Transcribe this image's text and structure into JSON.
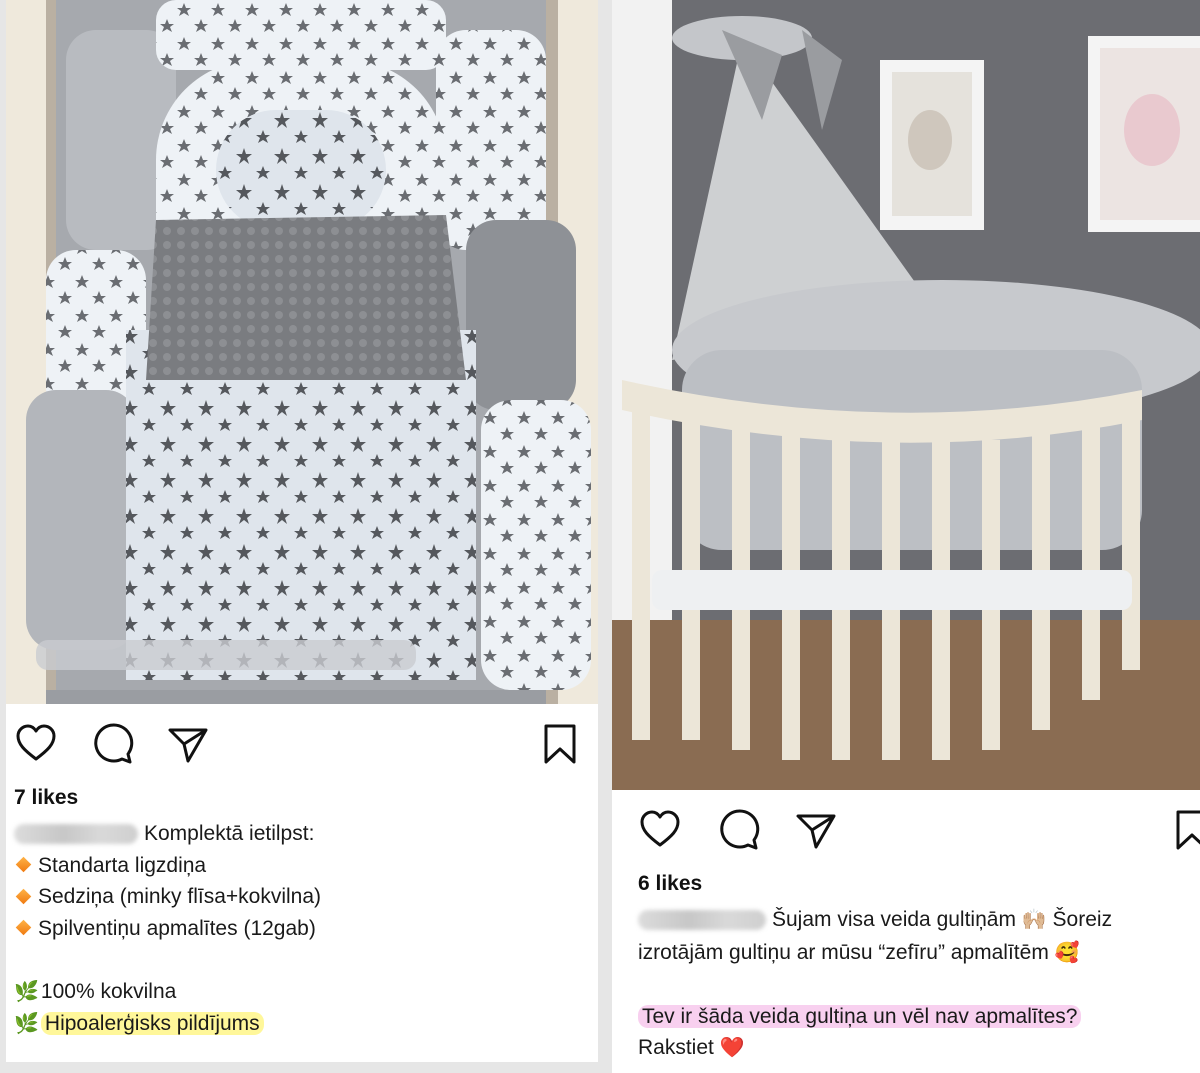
{
  "colors": {
    "page_background": "#e6e6e6",
    "icon_stroke": "#111111",
    "highlight_yellow": "#fff478",
    "highlight_pink": "#f096dc",
    "heart_emoji": "#e8253f"
  },
  "posts": [
    {
      "photo": {
        "subject": "baby crib set with grey star-print bumpers, nest and minky blanket"
      },
      "actions": {
        "like": "heart-icon",
        "comment": "comment-bubble-icon",
        "share": "paper-plane-icon",
        "save": "bookmark-icon"
      },
      "likes_text": "7 likes",
      "caption": {
        "intro": "Komplektā ietilpst:",
        "items": [
          "Standarta ligzdiņa",
          "Sedziņa (minky flīsa+kokvilna)",
          "Spilventiņu apmalītes (12gab)"
        ],
        "features": [
          {
            "text": "100% kokvilna",
            "highlighted": false
          },
          {
            "text": "Hipoalerģisks pildījums",
            "highlighted": true
          }
        ]
      }
    },
    {
      "photo": {
        "subject": "oval white crib with grey puffy bumpers, bows and tulle canopy"
      },
      "actions": {
        "like": "heart-icon",
        "comment": "comment-bubble-icon",
        "share": "paper-plane-icon",
        "save": "bookmark-icon"
      },
      "likes_text": "6 likes",
      "caption": {
        "line1": "Šujam visa veida gultiņām",
        "line1_emoji": "🙌🏼",
        "line1_tail": "Šoreiz",
        "line2": "izrotājām gultiņu ar mūsu “zefīru” apmalītēm",
        "line2_emoji": "🥰",
        "question": "Tev ir šāda veida gultiņa un vēl nav apmalītes?",
        "cta": "Rakstiet",
        "cta_emoji": "❤️"
      }
    }
  ]
}
